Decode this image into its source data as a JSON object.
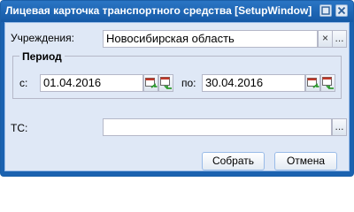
{
  "window": {
    "title": "Лицевая карточка транспортного средства [SetupWindow]"
  },
  "form": {
    "institution_label": "Учреждения:",
    "institution_value": "Новосибирская область",
    "clear_glyph": "×",
    "browse_glyph": "...",
    "period_legend": "Период",
    "from_label": "с:",
    "from_value": "01.04.2016",
    "to_label": "по:",
    "to_value": "30.04.2016",
    "ts_label": "ТС:",
    "ts_value": "",
    "ts_browse_glyph": "..."
  },
  "buttons": {
    "save_label": "Собрать",
    "cancel_label": "Отмена"
  },
  "icons": {
    "minimize": "minimize-icon",
    "close": "close-icon",
    "calendar": "calendar-icon"
  },
  "colors": {
    "title_bar": "#1b62b0",
    "body": "#dfe8f6",
    "border": "#99bbe8"
  }
}
